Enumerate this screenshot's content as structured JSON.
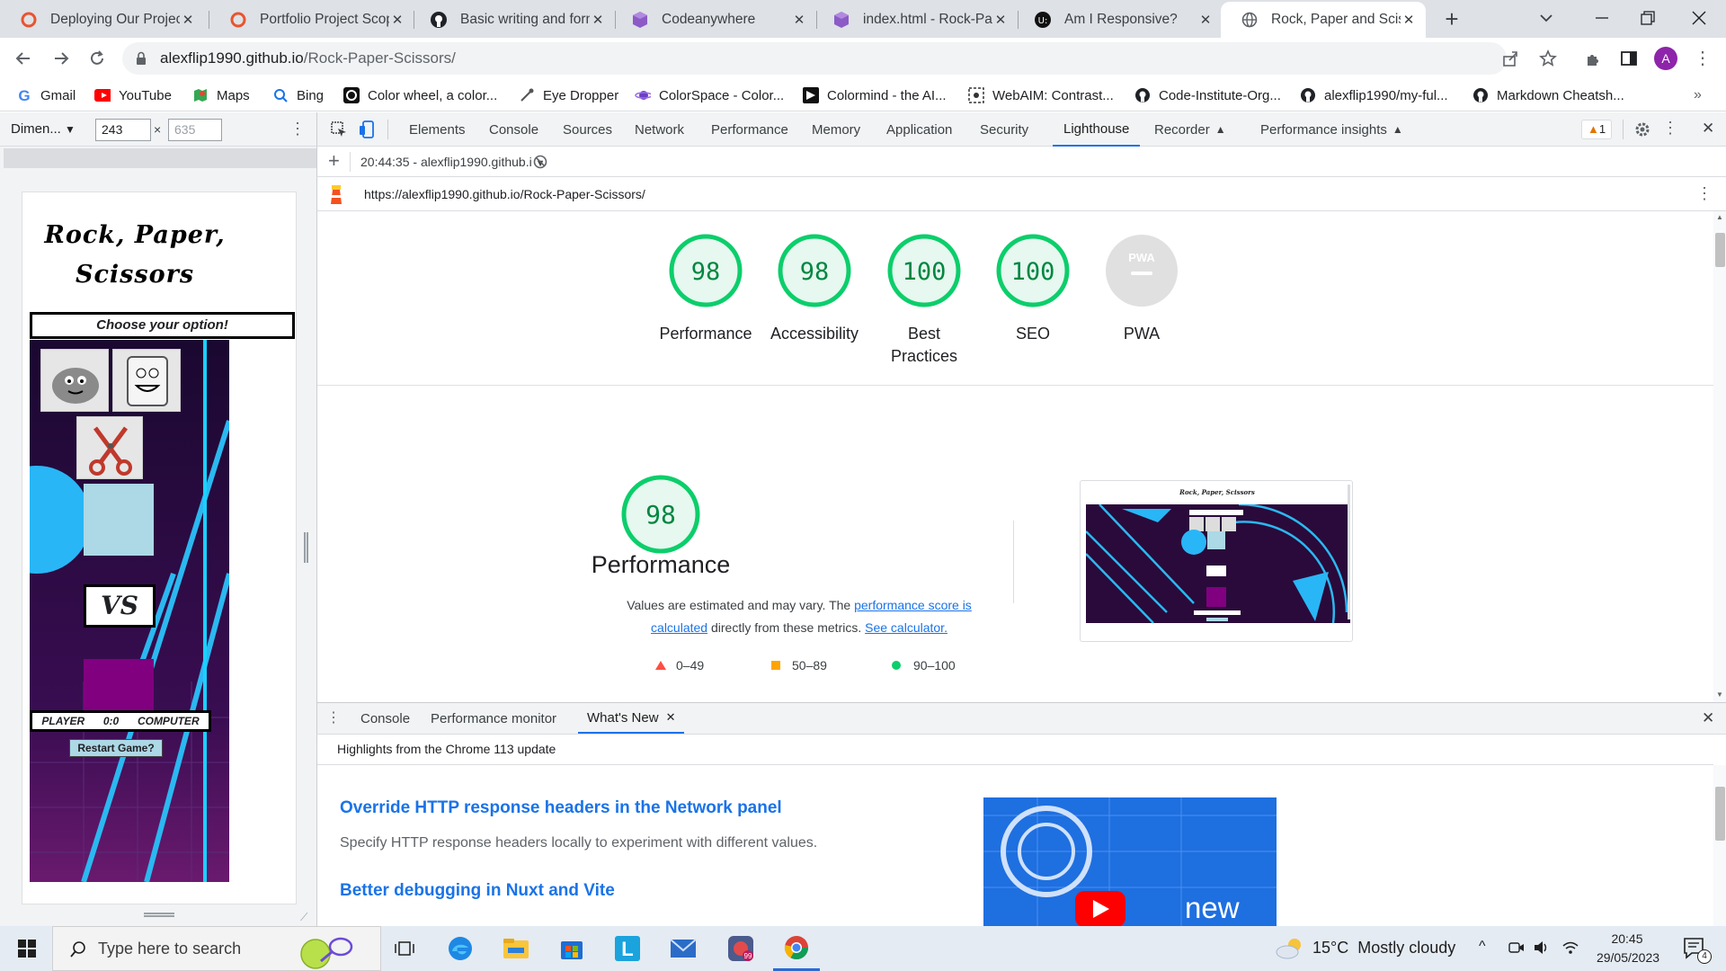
{
  "tabs": [
    {
      "title": "Deploying Our Project",
      "icon": "circle-orange-icon",
      "active": false
    },
    {
      "title": "Portfolio Project Scope",
      "icon": "circle-orange-icon",
      "active": false
    },
    {
      "title": "Basic writing and formatting",
      "icon": "github-icon",
      "active": false
    },
    {
      "title": "Codeanywhere",
      "icon": "cube-purple-icon",
      "active": false
    },
    {
      "title": "index.html - Rock-Paper",
      "icon": "cube-purple-icon",
      "active": false
    },
    {
      "title": "Am I Responsive?",
      "icon": "uu-icon",
      "active": false
    },
    {
      "title": "Rock, Paper and Scissors",
      "icon": "globe-icon",
      "active": true
    }
  ],
  "address": {
    "host": "alexflip1990.github.io",
    "path": "/Rock-Paper-Scissors/",
    "profile_initial": "A"
  },
  "bookmarks": [
    "Gmail",
    "YouTube",
    "Maps",
    "Bing",
    "Color wheel, a color...",
    "Eye Dropper",
    "ColorSpace - Color...",
    "Colormind - the AI...",
    "WebAIM: Contrast...",
    "Code-Institute-Org...",
    "alexflip1990/my-ful...",
    "Markdown Cheatsh..."
  ],
  "device": {
    "preset": "Dimen...",
    "width": "243",
    "height_placeholder": "635",
    "times": "×"
  },
  "game": {
    "title": "Rock, Paper, Scissors",
    "prompt": "Choose your option!",
    "vs": "VS",
    "player": "PLAYER",
    "score": "0:0",
    "computer": "COMPUTER",
    "restart": "Restart Game?"
  },
  "devtools": {
    "tabs": [
      "Elements",
      "Console",
      "Sources",
      "Network",
      "Performance",
      "Memory",
      "Application",
      "Security",
      "Lighthouse",
      "Recorder",
      "Performance insights"
    ],
    "active_tab": "Lighthouse",
    "warnings": "1",
    "report_time": "20:44:35 - alexflip1990.github.i",
    "report_url": "https://alexflip1990.github.io/Rock-Paper-Scissors/"
  },
  "scores": [
    {
      "label": "Performance",
      "value": 98
    },
    {
      "label": "Accessibility",
      "value": 98
    },
    {
      "label": "Best Practices",
      "value": 100
    },
    {
      "label": "SEO",
      "value": 100
    },
    {
      "label": "PWA",
      "value": null,
      "badge": "PWA"
    }
  ],
  "perf": {
    "score": 98,
    "title": "Performance",
    "desc_before": "Values are estimated and may vary. The ",
    "desc_link1": "performance score is calculated",
    "desc_mid": " directly from these metrics. ",
    "desc_link2": "See calculator.",
    "legend": [
      {
        "range": "0–49",
        "color": "#ff4e42"
      },
      {
        "range": "50–89",
        "color": "#ffa400"
      },
      {
        "range": "90–100",
        "color": "#0cce6b"
      }
    ]
  },
  "drawer": {
    "tabs": [
      "Console",
      "Performance monitor",
      "What's New"
    ],
    "active_tab": "What's New",
    "heading": "Highlights from the Chrome 113 update",
    "items": [
      {
        "title": "Override HTTP response headers in the Network panel",
        "desc": "Specify HTTP response headers locally to experiment with different values."
      },
      {
        "title": "Better debugging in Nuxt and Vite",
        "desc": ""
      }
    ],
    "video_word": "new"
  },
  "taskbar": {
    "search_placeholder": "Type here to search",
    "weather": "15°C  Mostly cloudy",
    "time": "20:45",
    "date": "29/05/2023",
    "notif_count": "4"
  },
  "colors": {
    "pass": "#0cce6b",
    "pass_text": "#018642",
    "link": "#1a73e8",
    "game_bg": "#2a0a3a",
    "accent_purple": "#800080"
  }
}
